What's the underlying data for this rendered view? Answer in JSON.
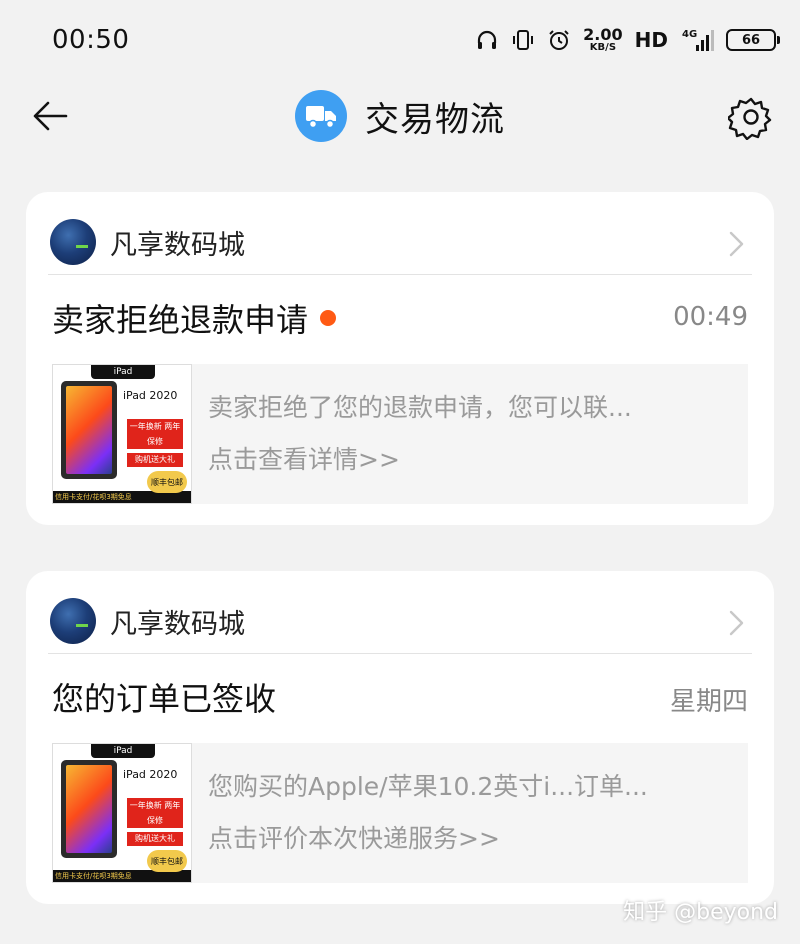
{
  "status_bar": {
    "time": "00:50",
    "net_speed_value": "2.00",
    "net_speed_unit": "KB/S",
    "hd": "HD",
    "network": "4G",
    "battery": "66"
  },
  "header": {
    "title": "交易物流",
    "icons": {
      "back": "back-arrow-icon",
      "truck": "truck-icon",
      "settings": "gear-icon"
    },
    "accent_color": "#3f9ff2"
  },
  "messages": [
    {
      "shop": "凡享数码城",
      "title": "卖家拒绝退款申请",
      "unread": true,
      "time": "00:49",
      "preview_line1": "卖家拒绝了您的退款申请，您可以联...",
      "preview_line2": "点击查看详情>>",
      "thumb": {
        "top_label": "iPad",
        "model": "iPad 2020",
        "badge1": "一年换新 两年保修",
        "badge2": "购机送大礼",
        "bottom": "信用卡支付/花呗3期免息",
        "sf": "顺丰包邮"
      }
    },
    {
      "shop": "凡享数码城",
      "title": "您的订单已签收",
      "unread": false,
      "time": "星期四",
      "preview_line1": "您购买的Apple/苹果10.2英寸i...订单...",
      "preview_line2": "点击评价本次快递服务>>",
      "thumb": {
        "top_label": "iPad",
        "model": "iPad 2020",
        "badge1": "一年换新 两年保修",
        "badge2": "购机送大礼",
        "bottom": "信用卡支付/花呗3期免息",
        "sf": "顺丰包邮"
      }
    }
  ],
  "watermark": "知乎 @beyond",
  "unread_dot_color": "#ff5a14"
}
